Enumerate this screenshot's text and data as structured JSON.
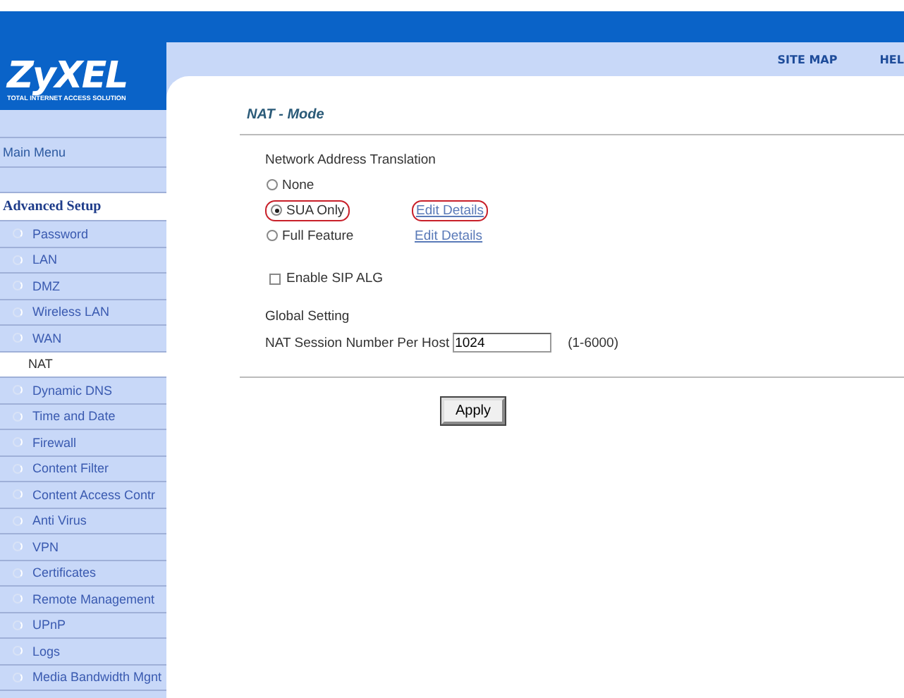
{
  "logo": {
    "name": "ZyXEL",
    "tagline": "TOTAL INTERNET ACCESS SOLUTION"
  },
  "header_links": [
    "SITE MAP",
    "HEL"
  ],
  "sidebar": {
    "main_menu": "Main Menu",
    "section": "Advanced Setup",
    "items": [
      {
        "label": "Password",
        "selected": false
      },
      {
        "label": "LAN",
        "selected": false
      },
      {
        "label": "DMZ",
        "selected": false
      },
      {
        "label": "Wireless LAN",
        "selected": false
      },
      {
        "label": "WAN",
        "selected": false
      },
      {
        "label": "NAT",
        "selected": true
      },
      {
        "label": "Dynamic DNS",
        "selected": false
      },
      {
        "label": "Time and Date",
        "selected": false
      },
      {
        "label": "Firewall",
        "selected": false
      },
      {
        "label": "Content Filter",
        "selected": false
      },
      {
        "label": "Content Access Contr",
        "selected": false
      },
      {
        "label": "Anti Virus",
        "selected": false
      },
      {
        "label": "VPN",
        "selected": false
      },
      {
        "label": "Certificates",
        "selected": false
      },
      {
        "label": "Remote Management",
        "selected": false
      },
      {
        "label": "UPnP",
        "selected": false
      },
      {
        "label": "Logs",
        "selected": false
      },
      {
        "label": "Media Bandwidth Mgnt",
        "selected": false
      }
    ]
  },
  "page": {
    "title": "NAT - Mode",
    "nat": {
      "label": "Network Address Translation",
      "options": [
        {
          "label": "None",
          "selected": false,
          "highlighted": false
        },
        {
          "label": "SUA Only",
          "selected": true,
          "highlighted": true,
          "link": {
            "label": "Edit Details",
            "highlighted": true
          }
        },
        {
          "label": "Full Feature",
          "selected": false,
          "highlighted": false,
          "link": {
            "label": "Edit Details",
            "highlighted": false
          }
        }
      ]
    },
    "sip": {
      "label": "Enable SIP ALG",
      "checked": false
    },
    "global": {
      "label": "Global Setting",
      "session": {
        "label": "NAT Session Number Per Host",
        "value": "1024",
        "hint": "(1-6000)"
      }
    },
    "apply": "Apply"
  }
}
